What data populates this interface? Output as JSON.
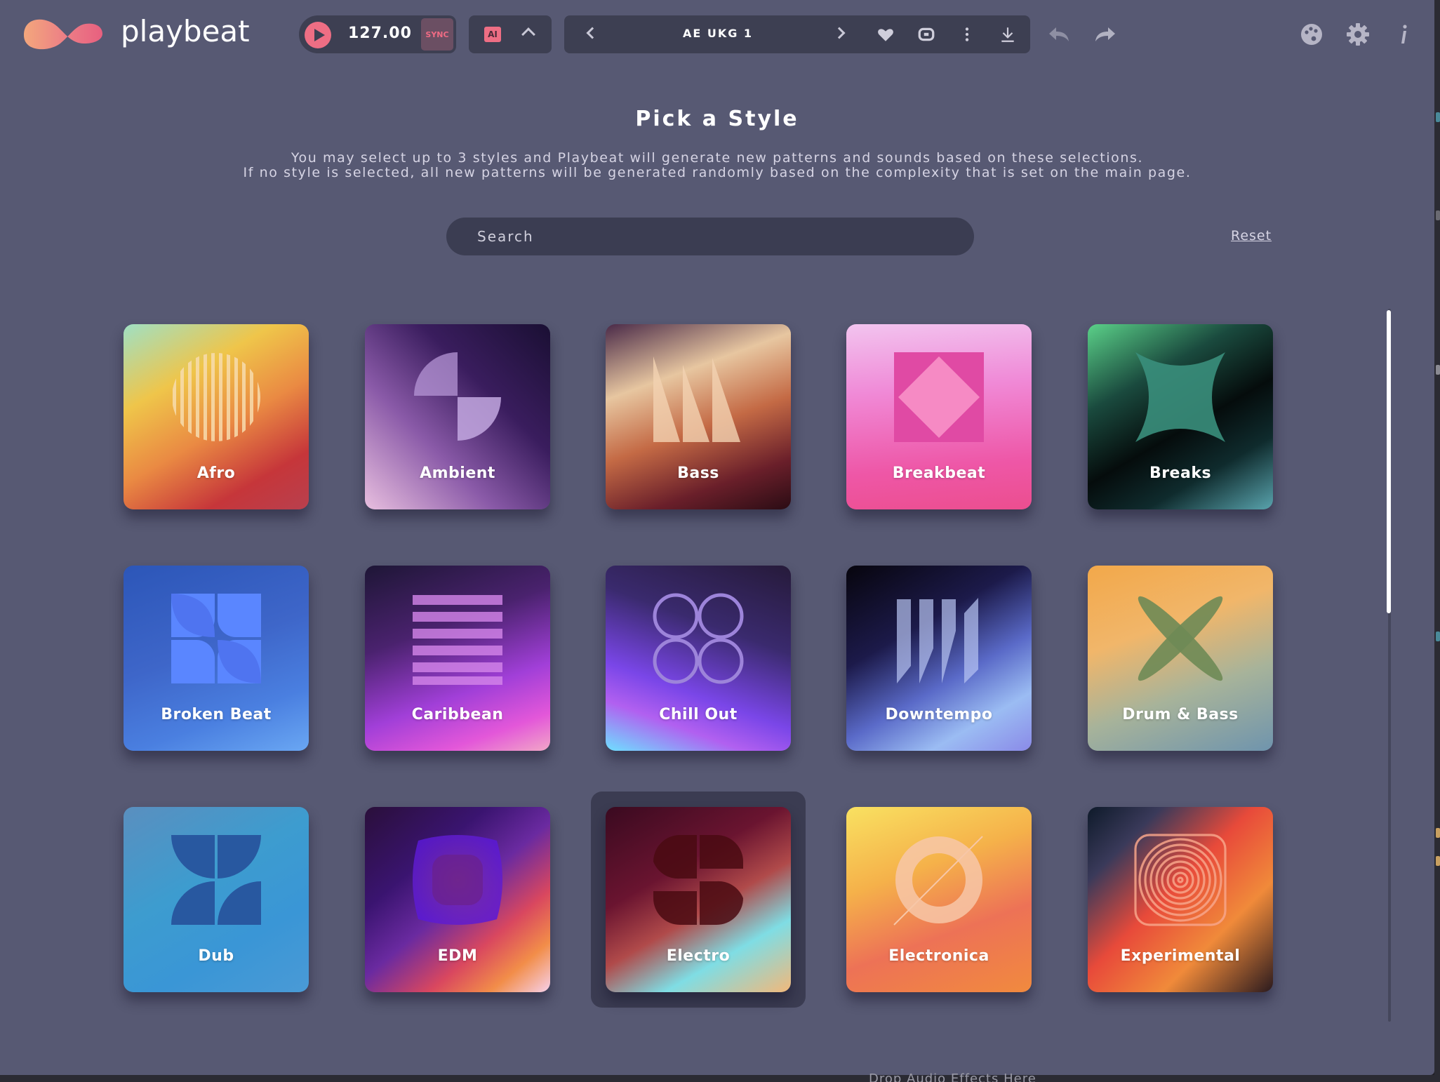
{
  "app": {
    "name": "playbeat"
  },
  "transport": {
    "play_icon": "play-icon",
    "bpm": "127.00",
    "sync_label": "SYNC"
  },
  "ai": {
    "badge": "AI",
    "toggle_icon": "chevron-up-icon"
  },
  "preset": {
    "name": "AE UKG 1",
    "icons": [
      "chevron-left-icon",
      "chevron-right-icon",
      "heart-icon",
      "shuffle-icon",
      "more-vertical-icon",
      "download-icon"
    ]
  },
  "header_actions": [
    "undo-icon",
    "redo-icon",
    "palette-icon",
    "gear-icon",
    "info-icon"
  ],
  "page": {
    "title": "Pick a Style",
    "description_line1": "You may select up to 3 styles and Playbeat will generate new patterns and sounds based on these selections.",
    "description_line2": "If no style is selected, all new patterns will be generated randomly based on the complexity that is set on the main page.",
    "search_placeholder": "Search",
    "reset_label": "Reset"
  },
  "styles": [
    {
      "label": "Afro"
    },
    {
      "label": "Ambient"
    },
    {
      "label": "Bass"
    },
    {
      "label": "Breakbeat"
    },
    {
      "label": "Breaks"
    },
    {
      "label": "Broken Beat"
    },
    {
      "label": "Caribbean"
    },
    {
      "label": "Chill Out"
    },
    {
      "label": "Downtempo"
    },
    {
      "label": "Drum & Bass"
    },
    {
      "label": "Dub"
    },
    {
      "label": "EDM"
    },
    {
      "label": "Electro",
      "selected": true
    },
    {
      "label": "Electronica"
    },
    {
      "label": "Experimental"
    }
  ],
  "host": {
    "drop_hint": "Drop Audio Effects Here"
  },
  "colors": {
    "window_bg": "#575973",
    "panel_bg": "#3d3f52",
    "accent": "#ee6e84"
  }
}
